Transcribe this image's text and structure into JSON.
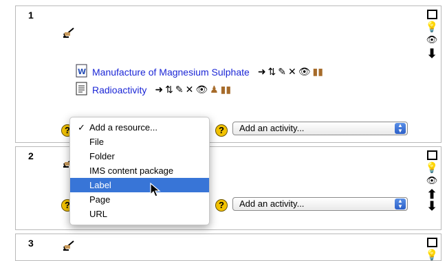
{
  "sections": [
    {
      "number": "1"
    },
    {
      "number": "2"
    },
    {
      "number": "3"
    }
  ],
  "resources": [
    {
      "label": "Manufacture of Magnesium Sulphate",
      "icon": "word-document-icon"
    },
    {
      "label": "Radioactivity",
      "icon": "page-icon"
    }
  ],
  "help_symbol": "?",
  "add_activity": "Add an activity...",
  "add_resource_menu": {
    "check": "✓",
    "items": [
      "Add a resource...",
      "File",
      "Folder",
      "IMS content package",
      "Label",
      "Page",
      "URL"
    ],
    "checked_index": 0,
    "highlighted_index": 4
  },
  "colors": {
    "link": "#1b26d6",
    "highlight": "#3875d7",
    "help": "#f2c200"
  }
}
